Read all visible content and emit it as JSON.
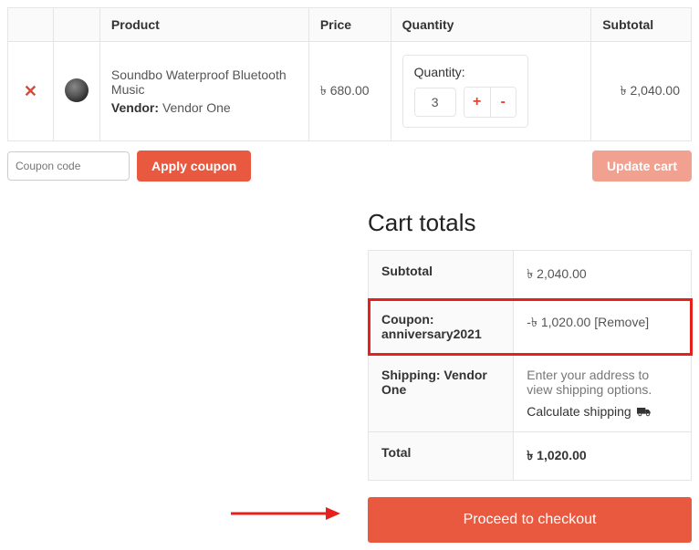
{
  "columns": {
    "product": "Product",
    "price": "Price",
    "quantity": "Quantity",
    "subtotal": "Subtotal"
  },
  "item": {
    "name": "Soundbo Waterproof Bluetooth Music",
    "vendor_label": "Vendor:",
    "vendor_name": "Vendor One",
    "price": "৳ 680.00",
    "qty_label": "Quantity:",
    "qty_value": "3",
    "subtotal": "৳ 2,040.00"
  },
  "coupon": {
    "placeholder": "Coupon code",
    "apply_label": "Apply coupon",
    "update_label": "Update cart"
  },
  "totals": {
    "title": "Cart totals",
    "subtotal_label": "Subtotal",
    "subtotal_value": "৳ 2,040.00",
    "coupon_label": "Coupon: anniversary2021",
    "coupon_value": "-৳ 1,020.00",
    "coupon_remove": "[Remove]",
    "shipping_label": "Shipping: Vendor One",
    "shipping_note": "Enter your address to view shipping options.",
    "calc_shipping": "Calculate shipping",
    "total_label": "Total",
    "total_value": "৳ 1,020.00",
    "checkout_label": "Proceed to checkout"
  }
}
